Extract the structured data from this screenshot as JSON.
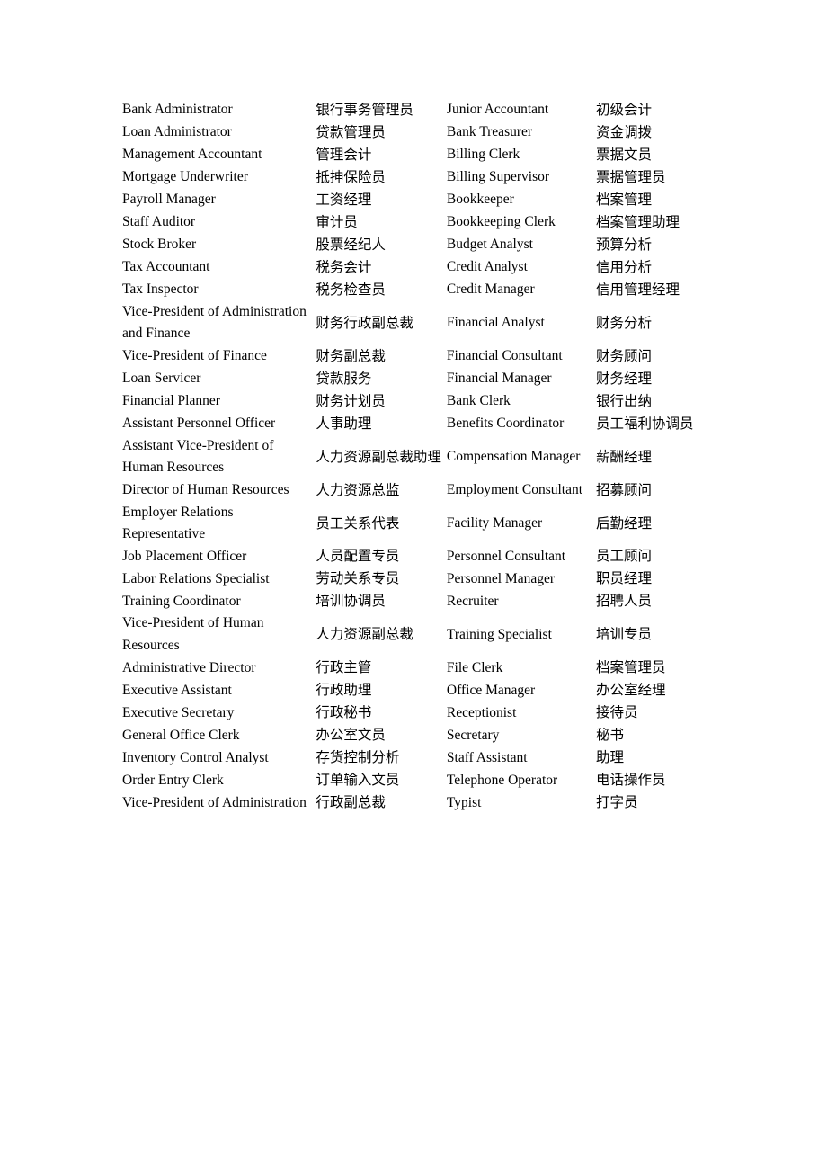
{
  "document": {
    "type": "bilingual-glossary-table",
    "language_pair": "English / Chinese",
    "columns": 4,
    "column_roles": [
      "english-term",
      "chinese-term",
      "english-term",
      "chinese-term"
    ]
  },
  "rows": [
    {
      "en_left": "Bank Administrator",
      "zh_left": "银行事务管理员",
      "en_right": "Junior Accountant",
      "zh_right": "初级会计"
    },
    {
      "en_left": "Loan Administrator",
      "zh_left": "贷款管理员",
      "en_right": "Bank Treasurer",
      "zh_right": "资金调拨"
    },
    {
      "en_left": "Management Accountant",
      "zh_left": "管理会计",
      "en_right": "Billing Clerk",
      "zh_right": "票据文员"
    },
    {
      "en_left": "Mortgage Underwriter",
      "zh_left": "抵抻保险员",
      "en_right": "Billing Supervisor",
      "zh_right": "票据管理员"
    },
    {
      "en_left": "Payroll Manager",
      "zh_left": "工资经理",
      "en_right": "Bookkeeper",
      "zh_right": "档案管理"
    },
    {
      "en_left": "Staff Auditor",
      "zh_left": "审计员",
      "en_right": "Bookkeeping Clerk",
      "zh_right": "档案管理助理"
    },
    {
      "en_left": "Stock Broker",
      "zh_left": "股票经纪人",
      "en_right": "Budget Analyst",
      "zh_right": "预算分析"
    },
    {
      "en_left": "Tax Accountant",
      "zh_left": "税务会计",
      "en_right": "Credit Analyst",
      "zh_right": "信用分析"
    },
    {
      "en_left": "Tax Inspector",
      "zh_left": "税务检查员",
      "en_right": "Credit Manager",
      "zh_right": "信用管理经理"
    },
    {
      "en_left": "Vice-President of Administration and Finance",
      "zh_left": "财务行政副总裁",
      "en_right": "Financial Analyst",
      "zh_right": "财务分析"
    },
    {
      "en_left": "Vice-President of Finance",
      "zh_left": "财务副总裁",
      "en_right": "Financial Consultant",
      "zh_right": "财务顾问"
    },
    {
      "en_left": "Loan Servicer",
      "zh_left": "贷款服务",
      "en_right": "Financial Manager",
      "zh_right": "财务经理"
    },
    {
      "en_left": "Financial Planner",
      "zh_left": "财务计划员",
      "en_right": "Bank Clerk",
      "zh_right": "银行出纳"
    },
    {
      "en_left": "Assistant Personnel Officer",
      "zh_left": "人事助理",
      "en_right": "Benefits Coordinator",
      "zh_right": "员工福利协调员"
    },
    {
      "en_left": "Assistant Vice-President of Human Resources",
      "zh_left": "人力资源副总裁助理",
      "en_right": "Compensation Manager",
      "zh_right": "薪酬经理"
    },
    {
      "en_left": "Director of Human Resources",
      "zh_left": "人力资源总监",
      "en_right": "Employment Consultant",
      "zh_right": "招募顾问"
    },
    {
      "en_left": "Employer Relations Representative",
      "zh_left": "员工关系代表",
      "en_right": "Facility Manager",
      "zh_right": "后勤经理"
    },
    {
      "en_left": "Job Placement Officer",
      "zh_left": "人员配置专员",
      "en_right": "Personnel Consultant",
      "zh_right": "员工顾问"
    },
    {
      "en_left": "Labor Relations Specialist",
      "zh_left": "劳动关系专员",
      "en_right": "Personnel Manager",
      "zh_right": "职员经理"
    },
    {
      "en_left": "Training Coordinator",
      "zh_left": "培训协调员",
      "en_right": "Recruiter",
      "zh_right": "招聘人员"
    },
    {
      "en_left": "Vice-President of Human Resources",
      "zh_left": "人力资源副总裁",
      "en_right": "Training Specialist",
      "zh_right": "培训专员"
    },
    {
      "en_left": "Administrative Director",
      "zh_left": "行政主管",
      "en_right": "File Clerk",
      "zh_right": "档案管理员"
    },
    {
      "en_left": "Executive Assistant",
      "zh_left": "行政助理",
      "en_right": "Office Manager",
      "zh_right": "办公室经理"
    },
    {
      "en_left": "Executive Secretary",
      "zh_left": "行政秘书",
      "en_right": "Receptionist",
      "zh_right": "接待员"
    },
    {
      "en_left": "General Office Clerk",
      "zh_left": "办公室文员",
      "en_right": "Secretary",
      "zh_right": "秘书"
    },
    {
      "en_left": "Inventory Control Analyst",
      "zh_left": "存货控制分析",
      "en_right": "Staff Assistant",
      "zh_right": "助理"
    },
    {
      "en_left": "Order Entry Clerk",
      "zh_left": "订单输入文员",
      "en_right": "Telephone Operator",
      "zh_right": "电话操作员"
    },
    {
      "en_left": "Vice-President of Administration",
      "zh_left": "行政副总裁",
      "en_right": "Typist",
      "zh_right": "打字员"
    }
  ]
}
